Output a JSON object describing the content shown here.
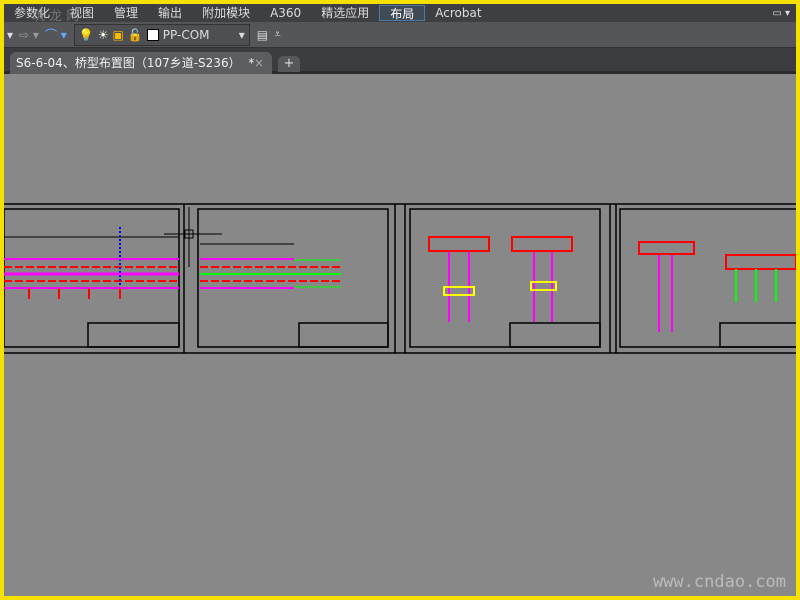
{
  "menubar": {
    "items": [
      "参数化",
      "视图",
      "管理",
      "输出",
      "附加模块",
      "A360",
      "精选应用",
      "布局",
      "Acrobat"
    ],
    "active": "布局"
  },
  "toolbar": {
    "layer_name": "PP-COM"
  },
  "tabs": {
    "document": "S6-6-04、桥型布置图（107乡道-S236）",
    "modified": "*",
    "close": "×",
    "new": "+"
  },
  "watermark": "www.cndao.com",
  "watermark_top": "筑 龙 网",
  "colors": {
    "background": "#888888",
    "frame": "#f5e000",
    "magenta": "#ff00ff",
    "green": "#00ff00",
    "red": "#ff0000"
  }
}
